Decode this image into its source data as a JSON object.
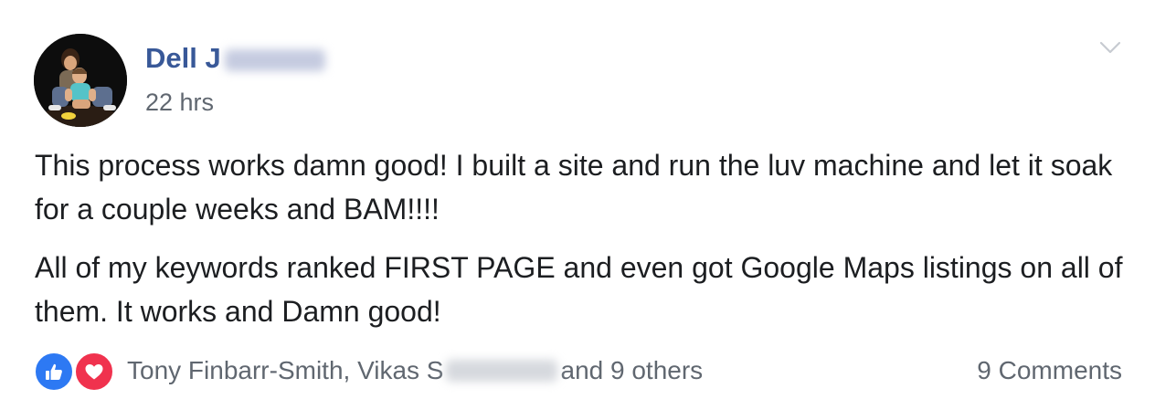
{
  "post": {
    "author": {
      "name_visible": "Dell J",
      "name_redacted": true
    },
    "timestamp": "22 hrs",
    "paragraphs": [
      "This process works damn good! I built a site and run the luv machine and let it soak for a couple weeks and BAM!!!!",
      "All of my keywords ranked FIRST PAGE and even got Google Maps listings on all of them. It works and Damn good!"
    ],
    "reactions": {
      "types": [
        "like-icon",
        "love-icon"
      ],
      "colors": {
        "like": "#2d79f3",
        "love": "#f0324e"
      },
      "reactors_prefix": "Tony Finbarr-Smith, Vikas S",
      "reactors_suffix": "and 9 others"
    },
    "comments_label": "9 Comments",
    "colors": {
      "author": "#385898",
      "meta": "#606770",
      "text": "#1c1e21"
    }
  }
}
